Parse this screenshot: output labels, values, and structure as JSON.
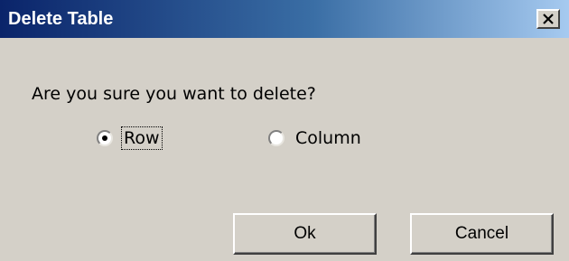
{
  "window": {
    "title": "Delete Table",
    "close_icon": "close-x-icon",
    "titlebar_colors": [
      "#0a246a",
      "#a6caf0"
    ]
  },
  "dialog": {
    "prompt": "Are you sure you want to delete?",
    "options": [
      {
        "label": "Row",
        "selected": true,
        "focused": true
      },
      {
        "label": "Column",
        "selected": false,
        "focused": false
      }
    ]
  },
  "buttons": {
    "ok_label": "Ok",
    "cancel_label": "Cancel"
  }
}
